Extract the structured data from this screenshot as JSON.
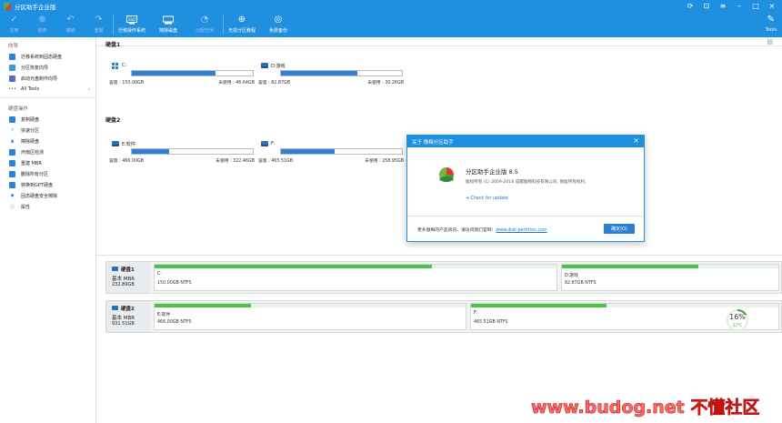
{
  "window": {
    "title": "分区助手企业版"
  },
  "toolbar": {
    "items": [
      {
        "label": "应用",
        "icon": "check-icon"
      },
      {
        "label": "放弃",
        "icon": "cancel-icon"
      },
      {
        "label": "撤销",
        "icon": "undo-icon"
      },
      {
        "label": "重做",
        "icon": "redo-icon"
      },
      {
        "label": "迁移操作系统",
        "icon": "migrate-os-icon"
      },
      {
        "label": "擦除磁盘",
        "icon": "wipe-disk-icon"
      },
      {
        "label": "分配空闲",
        "icon": "allocate-icon"
      },
      {
        "label": "无损分区教程",
        "icon": "tutorial-icon"
      },
      {
        "label": "免费备份",
        "icon": "backup-icon"
      }
    ],
    "tools_label": "Tools"
  },
  "sidebar": {
    "wizard_title": "向导",
    "wizard_items": [
      {
        "label": "迁移系统到固态硬盘",
        "color": "#2b83d6"
      },
      {
        "label": "分区恢复向导",
        "color": "#2b83d6"
      },
      {
        "label": "启动光盘制作向导",
        "color": "#2b83d6"
      },
      {
        "label": "All Tools",
        "color": "#888888"
      }
    ],
    "disk_ops_title": "硬盘操作",
    "disk_ops_items": [
      {
        "label": "复制硬盘",
        "color": "#2b83d6"
      },
      {
        "label": "快速分区",
        "color": "#2b83d6"
      },
      {
        "label": "擦除硬盘",
        "color": "#2b83d6"
      },
      {
        "label": "坏扇区检测",
        "color": "#2b83d6"
      },
      {
        "label": "重建 MBR",
        "color": "#2b83d6"
      },
      {
        "label": "删除所有分区",
        "color": "#2b83d6"
      },
      {
        "label": "转换到GPT硬盘",
        "color": "#2b83d6"
      },
      {
        "label": "固态硬盘安全擦除",
        "color": "#2b83d6"
      },
      {
        "label": "属性",
        "color": "#2b83d6"
      }
    ]
  },
  "disk1": {
    "title": "硬盘1",
    "partitions": [
      {
        "name": "C:",
        "capacity": "容量 : 150.00GB",
        "free": "未使用 : 46.64GB",
        "used_fraction": 0.69
      },
      {
        "name": "D:游戏",
        "capacity": "容量 : 82.87GB",
        "free": "未使用 : 30.26GB",
        "used_fraction": 0.63
      }
    ]
  },
  "disk2": {
    "title": "硬盘2",
    "partitions": [
      {
        "name": "E:软件",
        "capacity": "容量 : 466.00GB",
        "free": "未使用 : 322.46GB",
        "used_fraction": 0.31
      },
      {
        "name": "F:",
        "capacity": "容量 : 465.51GB",
        "free": "未使用 : 258.95GB",
        "used_fraction": 0.44
      }
    ]
  },
  "diskmap": [
    {
      "title": "硬盘1",
      "type": "基本 MBR",
      "size": "232.89GB",
      "parts": [
        {
          "label": "C:",
          "sub": "150.00GB NTFS",
          "fill": 0.69
        },
        {
          "label": "D:游戏",
          "sub": "82.87GB NTFS",
          "fill": 0.63
        }
      ]
    },
    {
      "title": "硬盘2",
      "type": "基本 MBR",
      "size": "931.51GB",
      "parts": [
        {
          "label": "E:软件",
          "sub": "466.00GB NTFS",
          "fill": 0.31
        },
        {
          "label": "F:",
          "sub": "465.51GB NTFS",
          "fill": 0.44
        }
      ]
    }
  ],
  "dialog": {
    "title": "关于 傲梅分区助手",
    "product": "分区助手企业版 8.5",
    "copyright": "版权所有 (C) 2009-2018 成都傲梅科技有限公司. 保留所有权利.",
    "check_update": "Check for update",
    "footer_text": "更多傲梅的产品资讯，请访问我们官网：",
    "footer_link": "www.disk-partition.com",
    "ok_label": "确定(O)"
  },
  "monitor": {
    "percent": "16%",
    "temp": "37°C",
    "value": 0.16
  },
  "watermark": {
    "text": "www.budog.net 不懂社区"
  },
  "colors": {
    "accent": "#1f8fe0",
    "bar_blue": "#2f7fd8",
    "bar_green": "#4cc44c"
  }
}
